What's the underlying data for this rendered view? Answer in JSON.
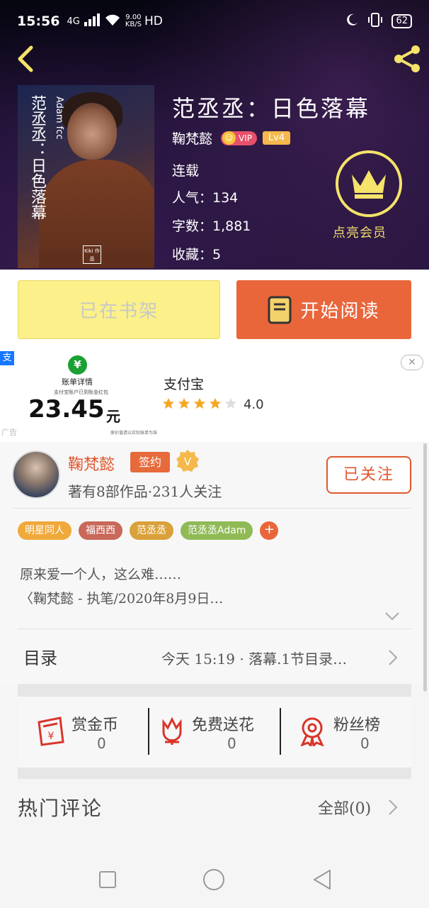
{
  "status_bar": {
    "time": "15:56",
    "network": "4G",
    "speed_value": "9.00",
    "speed_unit": "KB/S",
    "hd": "HD",
    "battery": "62"
  },
  "book": {
    "title": "范丞丞：日色落幕",
    "cover_title": "范丞丞：日色落幕",
    "cover_subtitle": "Adam fcc",
    "cover_logo": "Kiki 作品",
    "author": "鞠梵懿",
    "vip_label": "VIP",
    "level_label": "Lv4",
    "status": "连载",
    "popularity": "人气：134",
    "word_count": "字数：1,881",
    "favorites": "收藏：5",
    "member_label": "点亮会员"
  },
  "actions": {
    "shelf_label": "已在书架",
    "read_label": "开始阅读"
  },
  "ad": {
    "bill_title": "账单详情",
    "bill_subtitle": "支付宝账户已到账金红包",
    "amount": "23.45",
    "unit": "元",
    "fine_print": "原价值请以实际账单为准",
    "app_name": "支付宝",
    "rating": "4.0",
    "rating_value": 4,
    "close": "✕",
    "tag": "广告"
  },
  "author_card": {
    "name": "鞠梵懿",
    "sign_badge": "签约",
    "stats_line": "著有8部作品·231人关注",
    "follow_label": "已关注",
    "tags": [
      {
        "label": "明星同人",
        "color": "#f0a93b"
      },
      {
        "label": "福西西",
        "color": "#c9695a"
      },
      {
        "label": "范丞丞",
        "color": "#d9a13a"
      },
      {
        "label": "范丞丞Adam",
        "color": "#8fba55"
      }
    ],
    "tag_add": "+",
    "intro_line1": "原来爱一个人，这么难……",
    "intro_line2": "〈鞠梵懿 - 执笔/2020年8月9日…"
  },
  "toc": {
    "label": "目录",
    "latest": "今天 15:19 · 落幕.1节目录…"
  },
  "stats": [
    {
      "label": "赏金币",
      "value": "0",
      "icon": "reward-envelope-icon"
    },
    {
      "label": "免费送花",
      "value": "0",
      "icon": "flower-icon"
    },
    {
      "label": "粉丝榜",
      "value": "0",
      "icon": "medal-icon"
    }
  ],
  "comments": {
    "title": "热门评论",
    "all_label": "全部(0)"
  },
  "colors": {
    "accent_orange": "#e9663b",
    "crown_gold": "#f5e36a",
    "shelf_yellow": "#fbf08a"
  }
}
